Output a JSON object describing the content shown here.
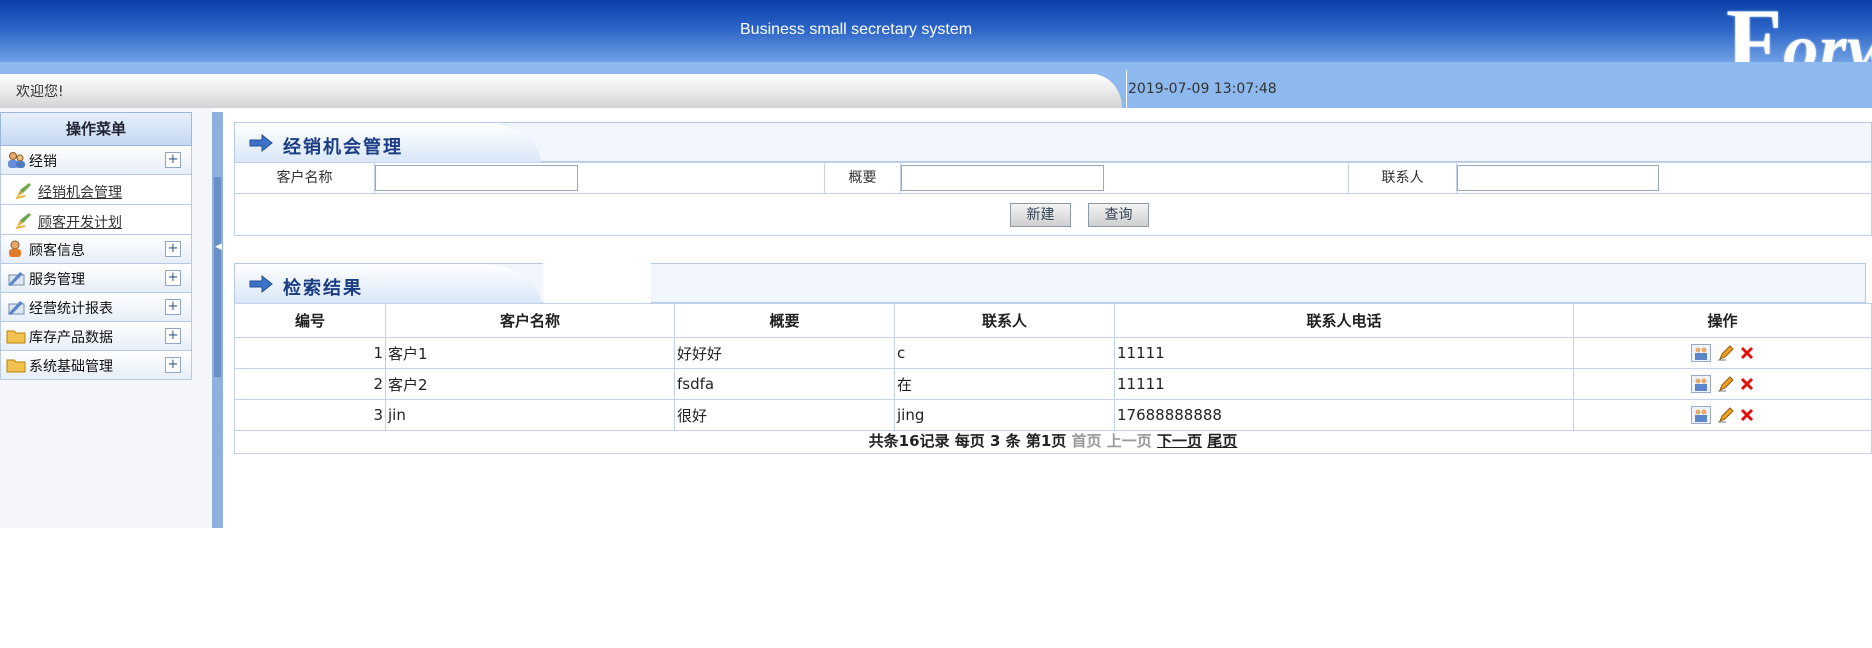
{
  "header": {
    "title": "Business small secretary system",
    "logo_text": "Forwar"
  },
  "subbar": {
    "welcome": "欢迎您!",
    "datetime": "2019-07-09 13:07:48"
  },
  "sidebar": {
    "title": "操作菜单",
    "groups": [
      {
        "label": "经销",
        "icon": "group-people-icon",
        "expand": "+"
      },
      {
        "label": "顾客信息",
        "icon": "customer-icon",
        "expand": "+"
      },
      {
        "label": "服务管理",
        "icon": "service-pen-icon",
        "expand": "+"
      },
      {
        "label": "经营统计报表",
        "icon": "report-pen-icon",
        "expand": "+"
      },
      {
        "label": "库存产品数据",
        "icon": "folder-icon",
        "expand": "+"
      },
      {
        "label": "系统基础管理",
        "icon": "folder-icon",
        "expand": "+"
      }
    ],
    "sub_items": [
      {
        "label": "经销机会管理",
        "icon": "pencil-pen-icon"
      },
      {
        "label": "顾客开发计划",
        "icon": "pencil-pen-icon"
      }
    ]
  },
  "search_panel": {
    "title": "经销机会管理",
    "fields": [
      {
        "label": "客户名称",
        "value": "",
        "placeholder": ""
      },
      {
        "label": "概要",
        "value": "",
        "placeholder": ""
      },
      {
        "label": "联系人",
        "value": "",
        "placeholder": ""
      }
    ],
    "buttons": {
      "new": "新建",
      "query": "查询"
    }
  },
  "results_panel": {
    "title": "检索结果",
    "columns": [
      "编号",
      "客户名称",
      "概要",
      "联系人",
      "联系人电话",
      "操作"
    ],
    "rows": [
      {
        "id": "1",
        "customer": "客户1",
        "summary": "好好好",
        "contact": "c",
        "phone": "11111"
      },
      {
        "id": "2",
        "customer": "客户2",
        "summary": "fsdfa",
        "contact": "在",
        "phone": "11111"
      },
      {
        "id": "3",
        "customer": "jin",
        "summary": "很好",
        "contact": "jing",
        "phone": "17688888888"
      }
    ],
    "row_actions": [
      "assign-people-icon",
      "edit-pencil-icon",
      "delete-x-icon"
    ],
    "pager": {
      "summary": "共条16记录 每页 3 条 第1页",
      "first": "首页",
      "prev": "上一页",
      "next": "下一页",
      "last": "尾页"
    }
  },
  "colors": {
    "header_dark": "#0a3fa8",
    "accent_title": "#1b3d84",
    "delete_red": "#e0140f"
  }
}
